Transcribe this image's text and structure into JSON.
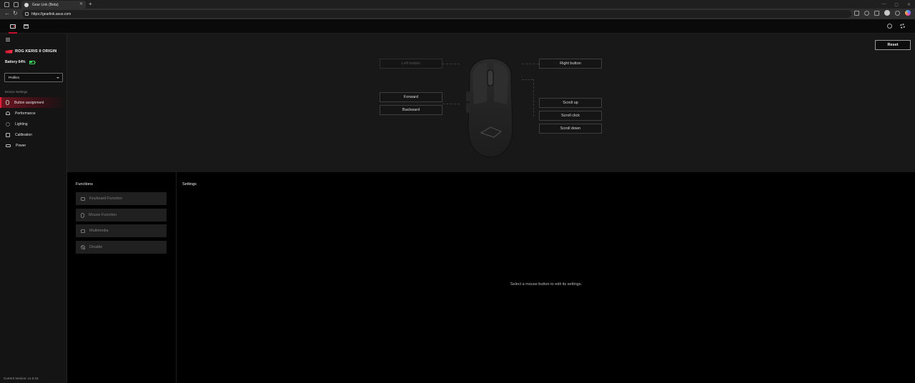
{
  "browser": {
    "tab_title": "Gear Link (Beta)",
    "url": "https://gearlink.asus.com"
  },
  "sidebar": {
    "device_name": "ROG KERIS II ORIGIN",
    "battery_label": "Battery 64%",
    "battery_level": 0.64,
    "profile_value": "Profile1",
    "section_label": "Device Settings",
    "items": [
      {
        "label": "Button assignment",
        "icon": "mouse-icon",
        "active": true
      },
      {
        "label": "Performance",
        "icon": "gauge-icon",
        "active": false
      },
      {
        "label": "Lighting",
        "icon": "lighting-icon",
        "active": false
      },
      {
        "label": "Calibration",
        "icon": "calibration-icon",
        "active": false
      },
      {
        "label": "Power",
        "icon": "battery-icon",
        "active": false
      }
    ],
    "version": "Current Version: v1.0.15"
  },
  "diagram": {
    "reset_label": "Reset",
    "left_button": "Left button",
    "right_button": "Right button",
    "forward": "Forward",
    "backward": "Backward",
    "scroll_up": "Scroll up",
    "scroll_click": "Scroll click",
    "scroll_down": "Scroll down"
  },
  "functions": {
    "title": "Functions",
    "items": [
      {
        "label": "Keyboard Function",
        "icon": "keyboard-icon"
      },
      {
        "label": "Mouse Function",
        "icon": "mouse-icon"
      },
      {
        "label": "Multimedia",
        "icon": "multimedia-icon"
      },
      {
        "label": "Disable",
        "icon": "disable-icon"
      }
    ]
  },
  "settings": {
    "title": "Settings",
    "hint": "Select a mouse button to edit its settings."
  },
  "colors": {
    "accent": "#c4122f",
    "battery": "#3ad05a"
  }
}
